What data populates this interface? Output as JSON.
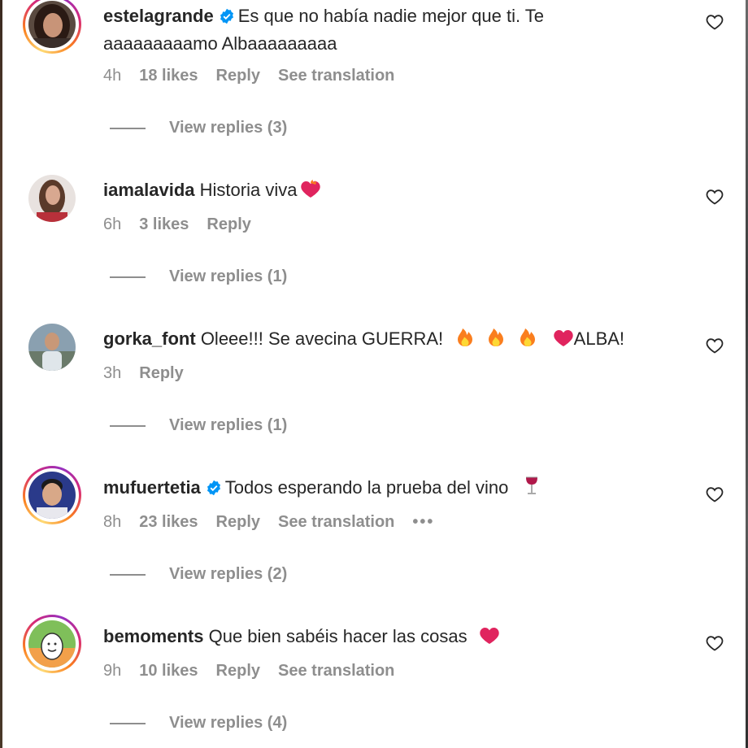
{
  "comments": [
    {
      "username": "estelagrande",
      "verified": true,
      "text_line1": "Es que no había nadie mejor que ti. Te",
      "text_line2": "aaaaaaaaamo Albaaaaaaaaa",
      "time": "4h",
      "likes": "18 likes",
      "reply": "Reply",
      "translation": "See translation",
      "view_replies": "View replies (3)",
      "avatar_icon": "avatar-woman-dark-hair",
      "story_ring": true
    },
    {
      "username": "iamalavida",
      "verified": false,
      "text": "Historia viva",
      "emoji": "heart-on-fire",
      "time": "6h",
      "likes": "3 likes",
      "reply": "Reply",
      "view_replies": "View replies (1)",
      "avatar_icon": "avatar-long-hair",
      "story_ring": false
    },
    {
      "username": "gorka_font",
      "verified": false,
      "text_a": "Oleee!!! Se avecina GUERRA!",
      "text_b": "ALBA!",
      "emoji": [
        "fire",
        "fire",
        "fire",
        "red-heart"
      ],
      "time": "3h",
      "reply": "Reply",
      "view_replies": "View replies (1)",
      "avatar_icon": "avatar-man-outdoor",
      "story_ring": false
    },
    {
      "username": "mufuertetia",
      "verified": true,
      "text": "Todos esperando la prueba del vino",
      "emoji": "wine-glass",
      "time": "8h",
      "likes": "23 likes",
      "reply": "Reply",
      "translation": "See translation",
      "more": "•••",
      "view_replies": "View replies (2)",
      "avatar_icon": "avatar-man-smiling",
      "story_ring": true
    },
    {
      "username": "bemoments",
      "verified": false,
      "text": "Que bien sabéis hacer las cosas",
      "emoji": "red-heart",
      "time": "9h",
      "likes": "10 likes",
      "reply": "Reply",
      "translation": "See translation",
      "view_replies": "View replies (4)",
      "avatar_icon": "avatar-egg-logo",
      "story_ring": true
    }
  ],
  "colors": {
    "text": "#262626",
    "secondary": "#8e8e8e",
    "verified": "#0095f6",
    "heart_red": "#e0245e"
  },
  "icons": {
    "like": "heart-outline-icon",
    "verified": "verified-badge-icon"
  }
}
